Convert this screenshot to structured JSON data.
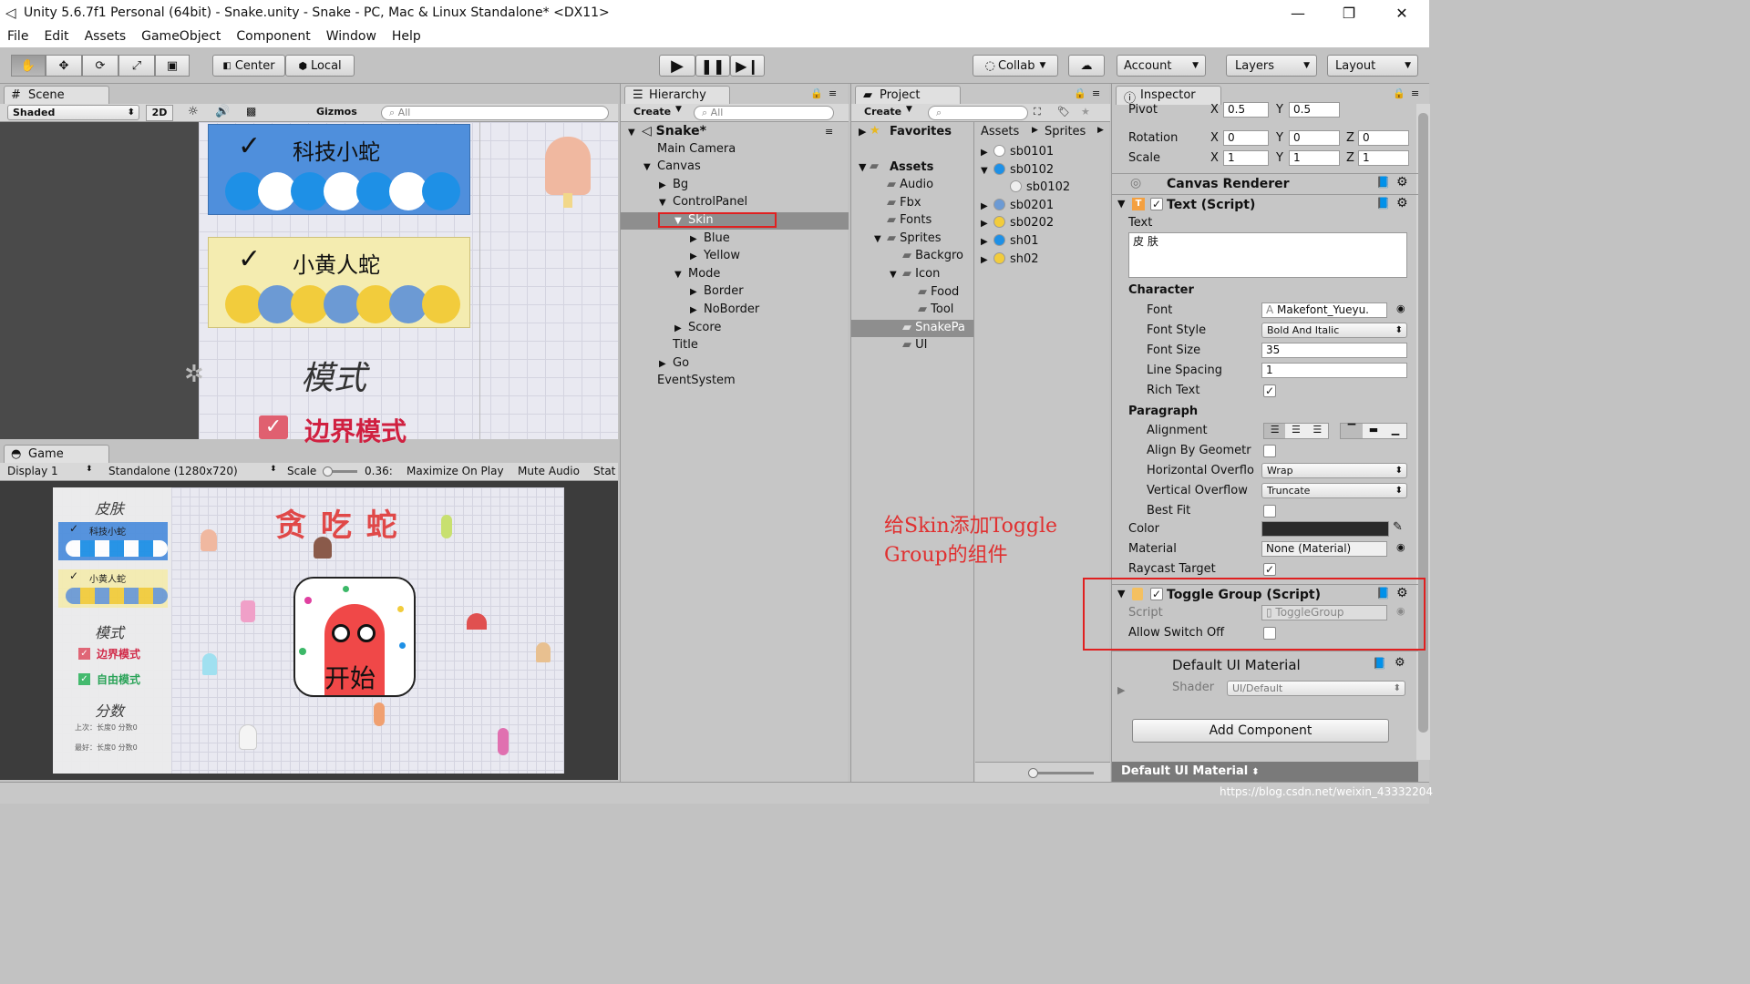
{
  "window": {
    "title": "Unity 5.6.7f1 Personal (64bit) - Snake.unity - Snake - PC, Mac & Linux Standalone* <DX11>",
    "minimize": "—",
    "maximize": "❐",
    "close": "✕"
  },
  "menu": [
    "File",
    "Edit",
    "Assets",
    "GameObject",
    "Component",
    "Window",
    "Help"
  ],
  "toolbar": {
    "center": "Center",
    "local": "Local",
    "collab": "Collab",
    "account": "Account",
    "layers": "Layers",
    "layout": "Layout"
  },
  "scene": {
    "tab": "Scene",
    "shading": "Shaded",
    "mode2d": "2D",
    "gizmos": "Gizmos",
    "search_placeholder": "All",
    "skin1_label": "科技小蛇",
    "skin2_label": "小黄人蛇",
    "mode_title": "模式",
    "border_mode": "边界模式"
  },
  "game": {
    "tab": "Game",
    "display": "Display 1",
    "resolution": "Standalone (1280x720)",
    "scale_label": "Scale",
    "scale_value": "0.36:",
    "maximize": "Maximize On Play",
    "mute": "Mute Audio",
    "stats": "Stat",
    "title": "贪 吃 蛇",
    "skin_title": "皮肤",
    "skin1": "科技小蛇",
    "skin2": "小黄人蛇",
    "mode_title": "模式",
    "border_mode": "边界模式",
    "free_mode": "自由模式",
    "score_title": "分数",
    "last_row": "上次：长度0  分数0",
    "best_row": "最好：长度0  分数0",
    "start": "开始"
  },
  "hierarchy": {
    "tab": "Hierarchy",
    "create": "Create",
    "search": "All",
    "items": [
      {
        "label": "Snake*",
        "indent": 0,
        "arrow": "▼",
        "bold": true
      },
      {
        "label": "Main Camera",
        "indent": 1,
        "arrow": ""
      },
      {
        "label": "Canvas",
        "indent": 1,
        "arrow": "▼"
      },
      {
        "label": "Bg",
        "indent": 2,
        "arrow": "▶"
      },
      {
        "label": "ControlPanel",
        "indent": 2,
        "arrow": "▼"
      },
      {
        "label": "Skin",
        "indent": 3,
        "arrow": "▼",
        "selected": true
      },
      {
        "label": "Blue",
        "indent": 4,
        "arrow": "▶"
      },
      {
        "label": "Yellow",
        "indent": 4,
        "arrow": "▶"
      },
      {
        "label": "Mode",
        "indent": 3,
        "arrow": "▼"
      },
      {
        "label": "Border",
        "indent": 4,
        "arrow": "▶"
      },
      {
        "label": "NoBorder",
        "indent": 4,
        "arrow": "▶"
      },
      {
        "label": "Score",
        "indent": 3,
        "arrow": "▶"
      },
      {
        "label": "Title",
        "indent": 2,
        "arrow": ""
      },
      {
        "label": "Go",
        "indent": 2,
        "arrow": "▶"
      },
      {
        "label": "EventSystem",
        "indent": 1,
        "arrow": ""
      }
    ]
  },
  "project": {
    "tab": "Project",
    "create": "Create",
    "favorites": "Favorites",
    "assets_root": "Assets",
    "breadcrumb": [
      "Assets",
      "Sprites"
    ],
    "folders": [
      {
        "label": "Audio",
        "indent": 1
      },
      {
        "label": "Fbx",
        "indent": 1
      },
      {
        "label": "Fonts",
        "indent": 1
      },
      {
        "label": "Sprites",
        "indent": 1,
        "arrow": "▼"
      },
      {
        "label": "Backgro",
        "indent": 2
      },
      {
        "label": "Icon",
        "indent": 2,
        "arrow": "▼"
      },
      {
        "label": "Food",
        "indent": 3
      },
      {
        "label": "Tool",
        "indent": 3
      },
      {
        "label": "SnakePa",
        "indent": 2,
        "selected": true
      },
      {
        "label": "UI",
        "indent": 2
      }
    ],
    "files": [
      {
        "label": "sb0101",
        "arrow": "▶"
      },
      {
        "label": "sb0102",
        "arrow": "▼"
      },
      {
        "label": "sb0102",
        "child": true
      },
      {
        "label": "sb0201",
        "arrow": "▶"
      },
      {
        "label": "sb0202",
        "arrow": "▶"
      },
      {
        "label": "sh01",
        "arrow": "▶"
      },
      {
        "label": "sh02",
        "arrow": "▶"
      }
    ]
  },
  "inspector": {
    "tab": "Inspector",
    "pivot_label": "Pivot",
    "pivot_x": "0.5",
    "pivot_y": "0.5",
    "rotation_label": "Rotation",
    "rot_x": "0",
    "rot_y": "0",
    "rot_z": "0",
    "scale_label": "Scale",
    "sc_x": "1",
    "sc_y": "1",
    "sc_z": "1",
    "canvas_renderer": "Canvas Renderer",
    "text_script": "Text (Script)",
    "text_label": "Text",
    "text_value": "皮 肤",
    "character": "Character",
    "font_label": "Font",
    "font_value": "Makefont_Yueyu.",
    "font_style_label": "Font Style",
    "font_style_value": "Bold And Italic",
    "font_size_label": "Font Size",
    "font_size_value": "35",
    "line_spacing_label": "Line Spacing",
    "line_spacing_value": "1",
    "rich_text_label": "Rich Text",
    "paragraph": "Paragraph",
    "alignment_label": "Alignment",
    "align_geom_label": "Align By Geometr",
    "hoverflow_label": "Horizontal Overflo",
    "hoverflow_value": "Wrap",
    "voverflow_label": "Vertical Overflow",
    "voverflow_value": "Truncate",
    "best_fit_label": "Best Fit",
    "color_label": "Color",
    "material_label": "Material",
    "material_value": "None (Material)",
    "raycast_label": "Raycast Target",
    "toggle_group": "Toggle Group (Script)",
    "script_label": "Script",
    "script_value": "ToggleGroup",
    "allow_switch_label": "Allow Switch Off",
    "default_material": "Default UI Material",
    "shader_label": "Shader",
    "shader_value": "UI/Default",
    "add_component": "Add Component",
    "bottom_bar": "Default UI Material"
  },
  "annotation": {
    "line1": "给Skin添加Toggle",
    "line2": "Group的组件"
  },
  "watermark": "https://blog.csdn.net/weixin_43332204",
  "colors": {
    "annotation": "#e03030",
    "highlight_box": "#e02020",
    "tech_snake": "#1e90e6",
    "yellow_snake": "#f2cc3c"
  }
}
